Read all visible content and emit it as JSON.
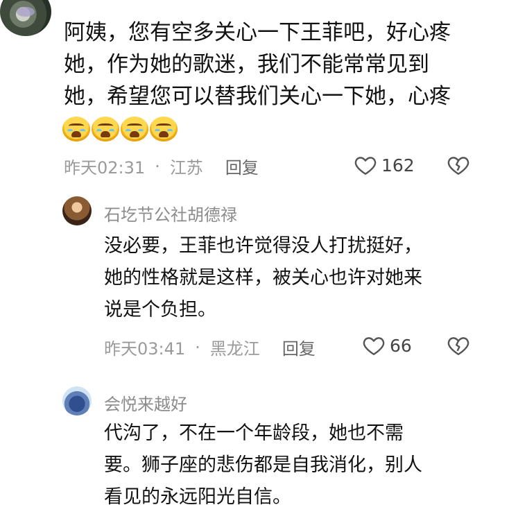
{
  "top_comment": {
    "text": "阿姨，您有空多关心一下王菲吧，好心疼\n她，作为她的歌迷，我们不能常常见到\n她，希望您可以替我们关心一下她，心疼",
    "emoji_count": 4,
    "time": "昨天02:31",
    "separator": "·",
    "location": "江苏",
    "reply_label": "回复",
    "likes": "162"
  },
  "replies": [
    {
      "author": "石圪节公社胡德禄",
      "text": "没必要，王菲也许觉得没人打扰挺好，\n她的性格就是这样，被关心也许对她来\n说是个负担。",
      "time": "昨天03:41",
      "separator": "·",
      "location": "黑龙江",
      "reply_label": "回复",
      "likes": "66"
    },
    {
      "author": "会悦来越好",
      "text": "代沟了，不在一个年龄段，她也不需\n要。狮子座的悲伤都是自我消化，别人\n看见的永远阳光自信。"
    }
  ]
}
